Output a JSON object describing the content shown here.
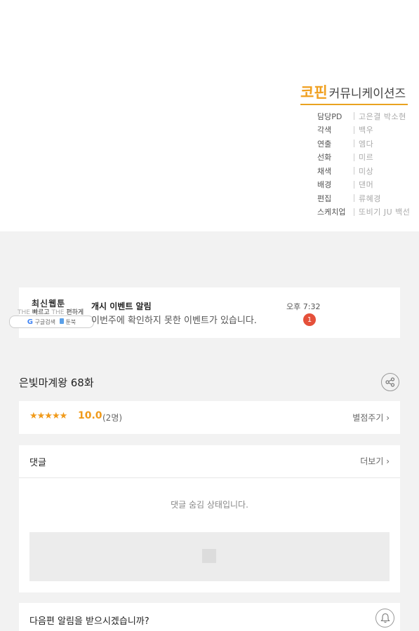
{
  "credits": {
    "brand_main": "코핀",
    "brand_sub": "커뮤니케이션즈",
    "rows": [
      {
        "k": "담당PD",
        "v": "고은결  박소현"
      },
      {
        "k": "각색",
        "v": "백우"
      },
      {
        "k": "연출",
        "v": "엠다"
      },
      {
        "k": "선화",
        "v": "미르"
      },
      {
        "k": "채색",
        "v": "미상"
      },
      {
        "k": "배경",
        "v": "댄머"
      },
      {
        "k": "편집",
        "v": "류혜경"
      },
      {
        "k": "스케치업",
        "v": "또비기  JU  백선"
      }
    ]
  },
  "notice": {
    "logo_title": "최신웹툰",
    "logo_the1": "THE",
    "logo_fast": "빠르고",
    "logo_the2": "THE",
    "logo_easy": "편하게",
    "logo_google": "구글검색",
    "logo_site": "툰북",
    "title": "개시 이벤트 알림",
    "time": "오후 7:32",
    "message": "이번주에 확인하지 못한 이벤트가 있습니다.",
    "badge": "1"
  },
  "episode": {
    "title": "은빛마계왕 68화"
  },
  "rating": {
    "stars": "★★★★★",
    "score": "10.0",
    "count": "(2명)",
    "rate_button": "별점주기 ›"
  },
  "comments": {
    "title": "댓글",
    "more": "더보기 ›",
    "hidden_message": "댓글 숨김 상태입니다."
  },
  "next": {
    "question": "다음편 알림을 받으시겠습니까?"
  },
  "colors": {
    "accent": "#f09a1a",
    "badge": "#e5503a",
    "background": "#f2f2f2"
  }
}
